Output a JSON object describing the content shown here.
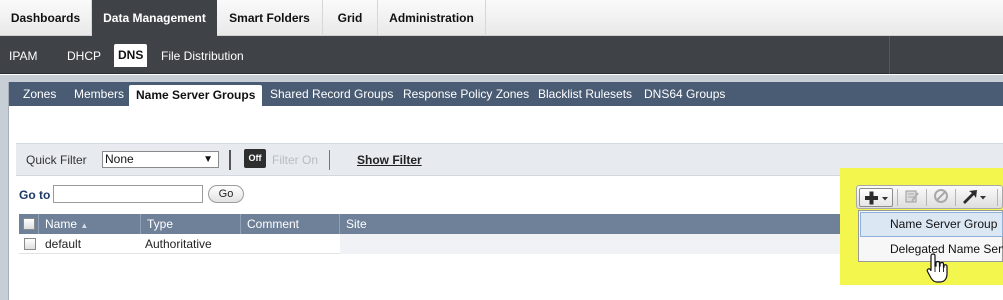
{
  "top_tabs": [
    {
      "label": "Dashboards"
    },
    {
      "label": "Data Management"
    },
    {
      "label": "Smart Folders"
    },
    {
      "label": "Grid"
    },
    {
      "label": "Administration"
    }
  ],
  "sub_tabs": [
    {
      "label": "IPAM"
    },
    {
      "label": "DHCP"
    },
    {
      "label": "DNS"
    },
    {
      "label": "File Distribution"
    }
  ],
  "dns_tabs": [
    {
      "label": "Zones"
    },
    {
      "label": "Members"
    },
    {
      "label": "Name Server Groups"
    },
    {
      "label": "Shared Record Groups"
    },
    {
      "label": "Response Policy Zones"
    },
    {
      "label": "Blacklist Rulesets"
    },
    {
      "label": "DNS64 Groups"
    }
  ],
  "filter": {
    "quick_filter_label": "Quick Filter",
    "quick_filter_value": "None",
    "dropdown_arrow": "▼",
    "off_label": "Off",
    "filter_on_label": "Filter On",
    "show_filter_label": "Show Filter"
  },
  "goto": {
    "label": "Go to",
    "input_value": "",
    "button_label": "Go"
  },
  "table": {
    "columns": [
      "Name",
      "Type",
      "Comment",
      "Site"
    ],
    "sort_indicator": "▲",
    "rows": [
      {
        "name": "default",
        "type": "Authoritative",
        "comment": "",
        "site": ""
      }
    ]
  },
  "add_menu": {
    "items": [
      {
        "label": "Name Server Group"
      },
      {
        "label": "Delegated Name Server"
      }
    ]
  },
  "icons": {
    "add": "plus-icon",
    "edit": "edit-icon",
    "disable": "disable-icon",
    "export": "arrow-icon"
  },
  "colors": {
    "highlight": "#f3f64d",
    "dark_bar": "#3f4347",
    "tab_bar_blue": "#4a5c74",
    "table_header": "#6f8099"
  }
}
